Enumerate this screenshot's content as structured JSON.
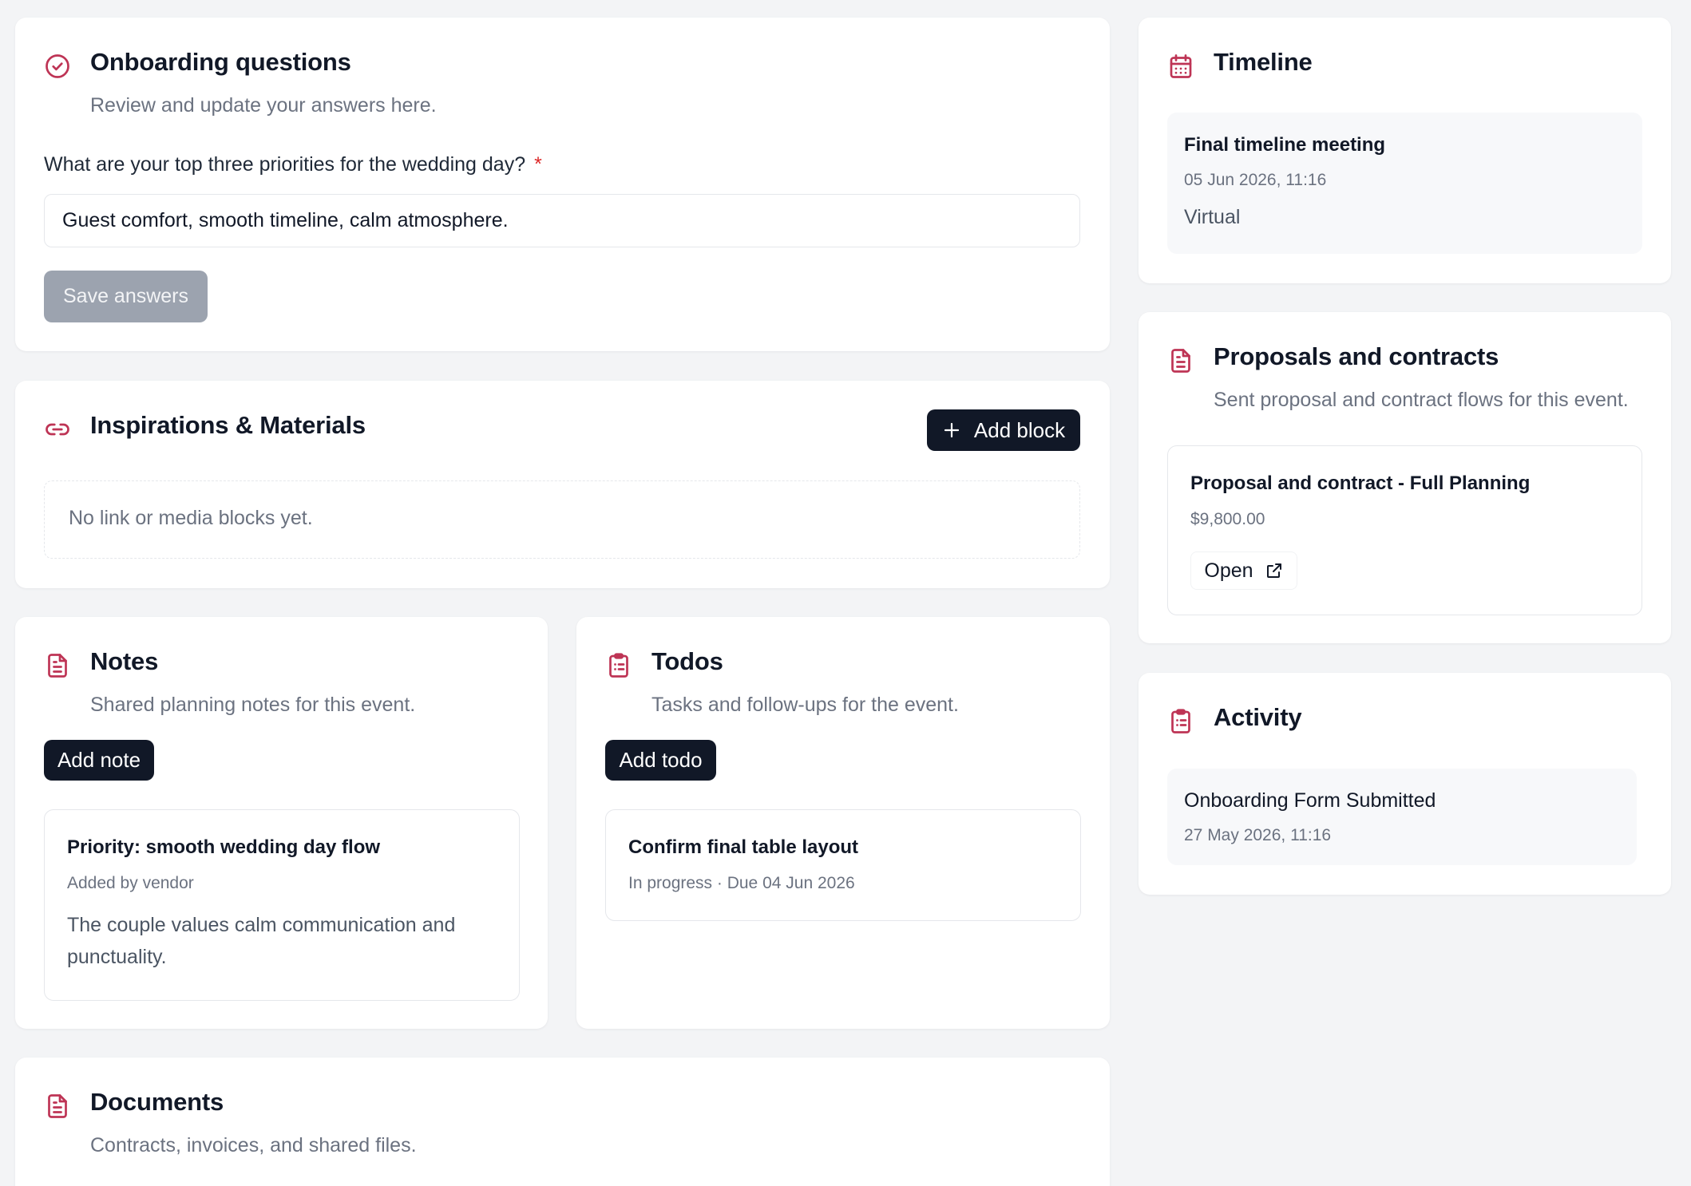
{
  "onboarding": {
    "title": "Onboarding questions",
    "subtitle": "Review and update your answers here.",
    "question": "What are your top three priorities for the wedding day?",
    "required_mark": "*",
    "answer": "Guest comfort, smooth timeline, calm atmosphere.",
    "save_label": "Save answers"
  },
  "inspirations": {
    "title": "Inspirations & Materials",
    "add_label": "Add block",
    "empty_text": "No link or media blocks yet."
  },
  "notes": {
    "title": "Notes",
    "subtitle": "Shared planning notes for this event.",
    "add_label": "Add note",
    "items": [
      {
        "title": "Priority: smooth wedding day flow",
        "meta": "Added by vendor",
        "body": "The couple values calm communication and punctuality."
      }
    ]
  },
  "todos": {
    "title": "Todos",
    "subtitle": "Tasks and follow-ups for the event.",
    "add_label": "Add todo",
    "items": [
      {
        "title": "Confirm final table layout",
        "meta": "In progress · Due 04 Jun 2026"
      }
    ]
  },
  "documents": {
    "title": "Documents",
    "subtitle": "Contracts, invoices, and shared files."
  },
  "timeline": {
    "title": "Timeline",
    "items": [
      {
        "title": "Final timeline meeting",
        "datetime": "05 Jun 2026, 11:16",
        "location": "Virtual"
      }
    ]
  },
  "proposals": {
    "title": "Proposals and contracts",
    "subtitle": "Sent proposal and contract flows for this event.",
    "items": [
      {
        "title": "Proposal and contract - Full Planning",
        "amount": "$9,800.00",
        "open_label": "Open"
      }
    ]
  },
  "activity": {
    "title": "Activity",
    "items": [
      {
        "title": "Onboarding Form Submitted",
        "datetime": "27 May 2026, 11:16"
      }
    ]
  },
  "colors": {
    "accent": "#be3455",
    "dark": "#111827",
    "muted": "#6b7280",
    "disabled_button": "#9ca3af",
    "background": "#f3f4f6"
  },
  "icons": {
    "onboarding": "check-circle-icon",
    "inspirations": "link-icon",
    "notes": "document-icon",
    "todos": "clipboard-list-icon",
    "documents": "document-icon",
    "timeline": "calendar-icon",
    "proposals": "document-icon",
    "activity": "clipboard-list-icon",
    "add_block": "plus-icon",
    "open": "external-link-icon"
  }
}
